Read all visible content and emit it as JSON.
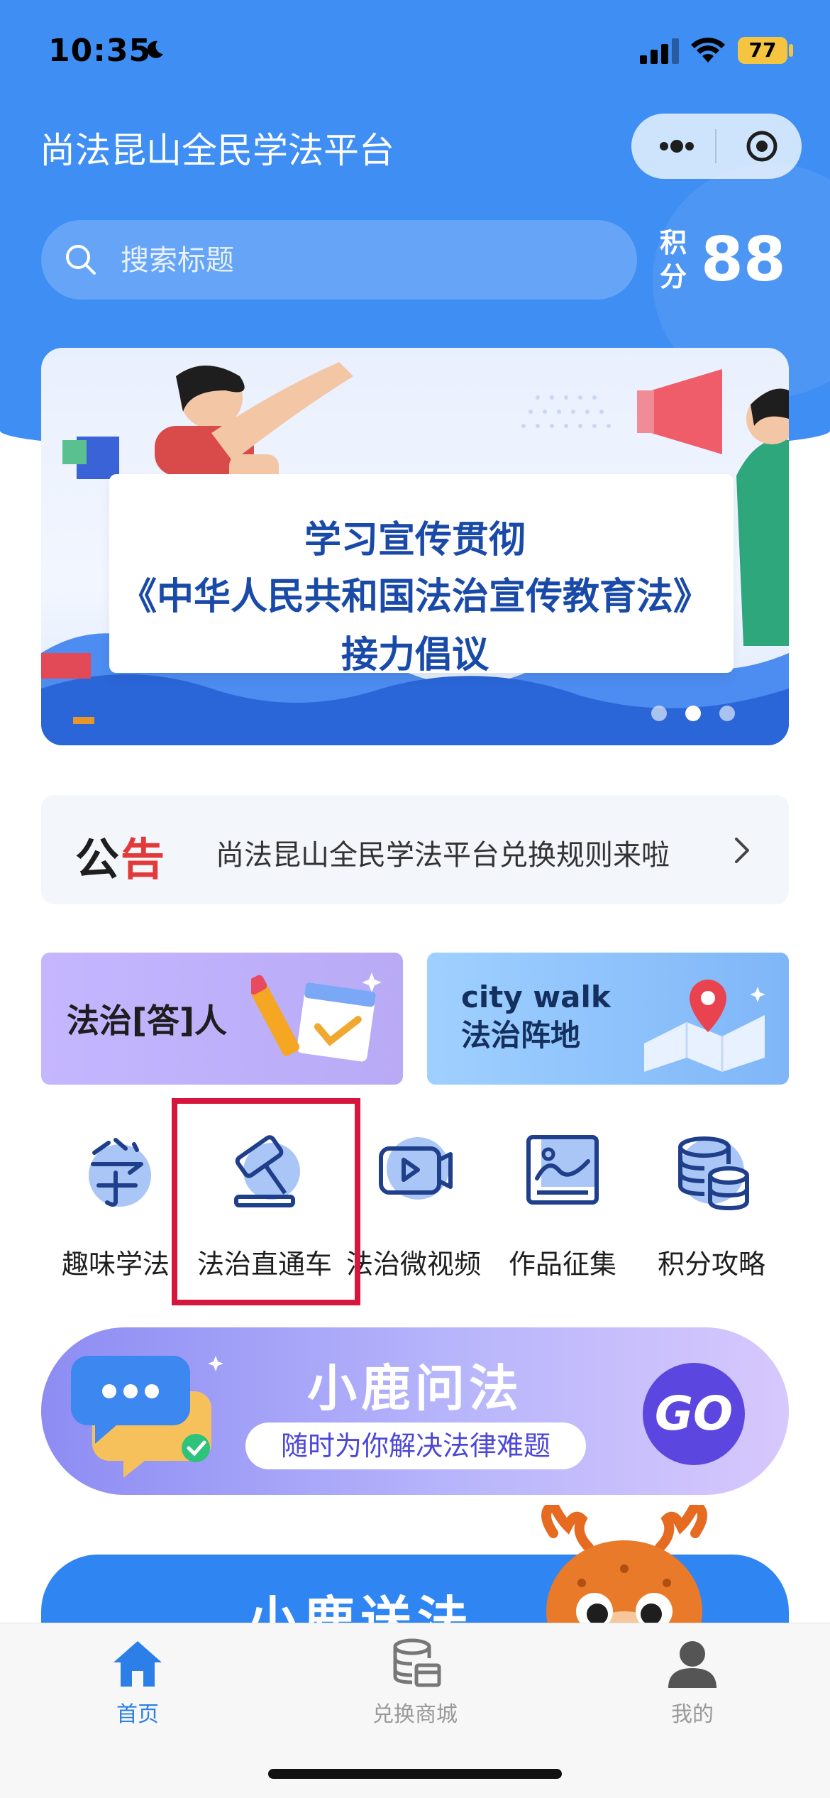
{
  "status_bar": {
    "time": "10:35",
    "battery": "77"
  },
  "header": {
    "title": "尚法昆山全民学法平台"
  },
  "search": {
    "placeholder": "搜索标题",
    "value": ""
  },
  "points": {
    "label": "积分",
    "value": "88"
  },
  "banner": {
    "line1": "学习宣传贯彻",
    "line2": "《中华人民共和国法治宣传教育法》",
    "line3": "接力倡议",
    "page_count": 3,
    "active_index": 1
  },
  "notice": {
    "tag_part1": "公",
    "tag_part2": "告",
    "text": "尚法昆山全民学法平台兑换规则来啦"
  },
  "promos": {
    "left_title": "法治[答]人",
    "right_line1": "city walk",
    "right_line2": "法治阵地"
  },
  "quick_icons": [
    {
      "label": "趣味学法",
      "icon": "study-icon"
    },
    {
      "label": "法治直通车",
      "icon": "gavel-icon"
    },
    {
      "label": "法治微视频",
      "icon": "video-icon"
    },
    {
      "label": "作品征集",
      "icon": "gallery-icon"
    },
    {
      "label": "积分攻略",
      "icon": "coins-icon"
    }
  ],
  "ask_banner": {
    "title": "小鹿问法",
    "subtitle": "随时为你解决法律难题",
    "button": "GO"
  },
  "send_banner": {
    "title": "小鹿送法"
  },
  "tabbar": {
    "items": [
      {
        "label": "首页",
        "icon": "home-icon",
        "active": true
      },
      {
        "label": "兑换商城",
        "icon": "store-icon",
        "active": false
      },
      {
        "label": "我的",
        "icon": "profile-icon",
        "active": false
      }
    ]
  },
  "colors": {
    "primary": "#3f8ef4",
    "tab_active": "#2b7fe6",
    "tab_inactive": "#999999",
    "highlight": "#d7163d"
  }
}
